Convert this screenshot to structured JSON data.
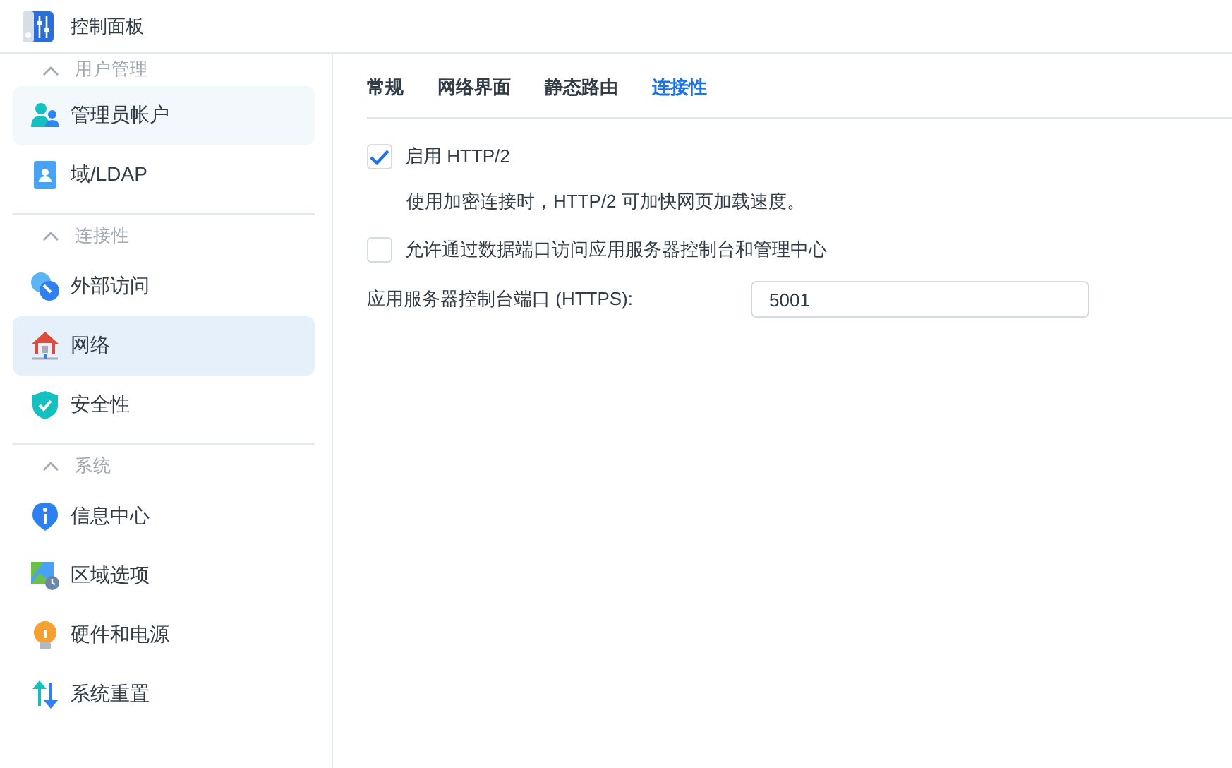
{
  "window": {
    "title": "控制面板"
  },
  "sidebar": {
    "groups": [
      {
        "title": "用户管理",
        "expanded": true,
        "items": [
          {
            "label": "管理员帐户",
            "selected": false,
            "hovered": true
          },
          {
            "label": "域/LDAP",
            "selected": false,
            "hovered": false
          }
        ]
      },
      {
        "title": "连接性",
        "expanded": true,
        "items": [
          {
            "label": "外部访问",
            "selected": false,
            "hovered": false
          },
          {
            "label": "网络",
            "selected": true,
            "hovered": false
          },
          {
            "label": "安全性",
            "selected": false,
            "hovered": false
          }
        ]
      },
      {
        "title": "系统",
        "expanded": true,
        "items": [
          {
            "label": "信息中心",
            "selected": false,
            "hovered": false
          },
          {
            "label": "区域选项",
            "selected": false,
            "hovered": false
          },
          {
            "label": "硬件和电源",
            "selected": false,
            "hovered": false
          },
          {
            "label": "系统重置",
            "selected": false,
            "hovered": false
          }
        ]
      }
    ]
  },
  "tabs": [
    {
      "label": "常规",
      "selected": false
    },
    {
      "label": "网络界面",
      "selected": false
    },
    {
      "label": "静态路由",
      "selected": false
    },
    {
      "label": "连接性",
      "selected": true
    }
  ],
  "settings": [
    {
      "kind": "checkbox",
      "label": "启用 HTTP/2",
      "checked": true
    },
    {
      "kind": "note",
      "text": "使用加密连接时，HTTP/2 可加快网页加载速度。"
    },
    {
      "kind": "checkbox",
      "label": "允许通过数据端口访问应用服务器控制台和管理中心",
      "checked": false
    },
    {
      "kind": "field",
      "label": "应用服务器控制台端口 (HTTPS):",
      "value": "5001"
    }
  ]
}
